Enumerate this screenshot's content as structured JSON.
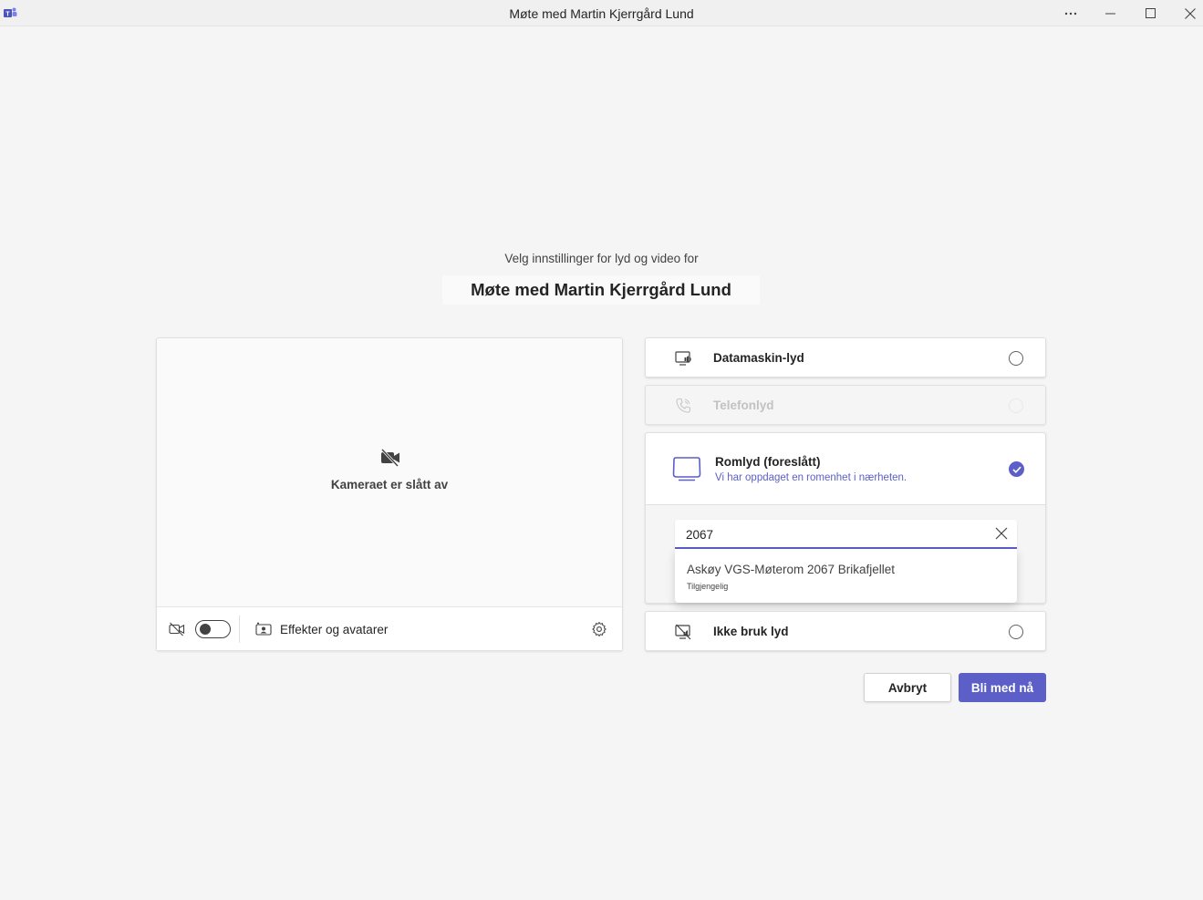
{
  "window": {
    "title": "Møte med Martin Kjerrgård Lund",
    "controls": [
      "more-options",
      "minimize",
      "maximize",
      "close"
    ]
  },
  "header": {
    "subtitle": "Velg innstillinger for lyd og video for",
    "meeting_title": "Møte med Martin Kjerrgård Lund"
  },
  "video": {
    "camera_off_text": "Kameraet er slått av",
    "camera_toggle_on": false,
    "effects_label": "Effekter og avatarer"
  },
  "audio": {
    "computer": {
      "label": "Datamaskin-lyd",
      "selected": false
    },
    "phone": {
      "label": "Telefonlyd",
      "disabled": true
    },
    "room": {
      "label": "Romlyd (foreslått)",
      "description": "Vi har oppdaget en romenhet i nærheten.",
      "selected": true,
      "search_value": "2067",
      "results": [
        {
          "name": "Askøy VGS-Møterom 2067 Brikafjellet",
          "status": "Tilgjengelig"
        }
      ]
    },
    "none": {
      "label": "Ikke bruk lyd",
      "selected": false
    }
  },
  "actions": {
    "cancel_label": "Avbryt",
    "join_label": "Bli med nå"
  },
  "colors": {
    "accent": "#5b5fc7",
    "background": "#f5f5f5"
  }
}
